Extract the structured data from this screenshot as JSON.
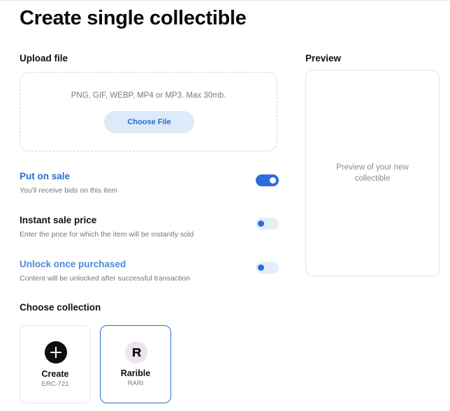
{
  "page": {
    "title": "Create single collectible"
  },
  "upload": {
    "label": "Upload file",
    "hint": "PNG, GIF, WEBP, MP4 or MP3. Max 30mb.",
    "button_label": "Choose File"
  },
  "preview": {
    "label": "Preview",
    "placeholder": "Preview of your new collectible"
  },
  "options": {
    "put_on_sale": {
      "title": "Put on sale",
      "subtitle": "You'll receive bids on this item",
      "enabled": true
    },
    "instant_sale_price": {
      "title": "Instant sale price",
      "subtitle": "Enter the price for which the item will be instantly sold",
      "enabled": false
    },
    "unlock_once_purchased": {
      "title": "Unlock once purchased",
      "subtitle": "Content will be unlocked after successful transaction",
      "enabled": false
    }
  },
  "collection": {
    "label": "Choose collection",
    "items": [
      {
        "name": "Create",
        "subtitle": "ERC-721",
        "icon": "plus-icon",
        "selected": false
      },
      {
        "name": "Rarible",
        "subtitle": "RARI",
        "icon": "rarible-logo-icon",
        "selected": true
      }
    ]
  },
  "colors": {
    "accent": "#2b6de0",
    "link_blue": "#1f6fd0",
    "button_bg": "#dcebfa"
  }
}
